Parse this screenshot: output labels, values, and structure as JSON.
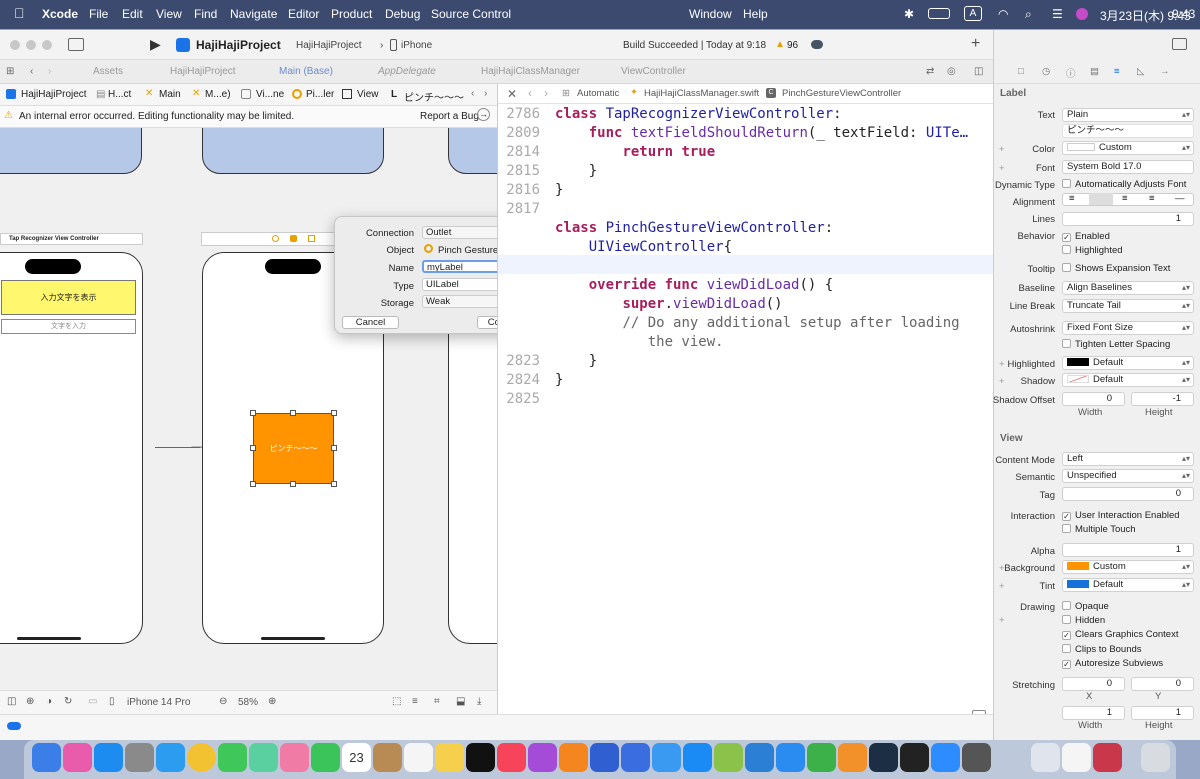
{
  "menubar": {
    "apple": "",
    "items": [
      "Xcode",
      "File",
      "Edit",
      "View",
      "Find",
      "Navigate",
      "Editor",
      "Product",
      "Debug",
      "Source Control",
      "Window",
      "Help"
    ],
    "input_mode": "A",
    "datetime": "3月23日(木) 9:43"
  },
  "toolbar": {
    "scheme": "HajiHajiProject",
    "device": "HajiHajiProject",
    "destination": "iPhone",
    "status": "Build Succeeded | Today at 9:18",
    "warnings": "96"
  },
  "tabs": [
    "Assets",
    "HajiHajiProject",
    "Main (Base)",
    "AppDelegate",
    "HajiHajiClassManager",
    "ViewController"
  ],
  "ib_jumpbar": [
    "HajiHajiProject",
    "H...ct",
    "Main",
    "M...e)",
    "Vi...ne",
    "Pi...ler",
    "View",
    "L",
    "ピンチ〜〜〜"
  ],
  "warning": {
    "text": "An internal error occurred. Editing functionality may be limited.",
    "action": "Report a Bug"
  },
  "canvas": {
    "scene1_title": "Tap Recognizer View Controller",
    "yellow_label": "入力文字を表示",
    "textfield_placeholder": "文字を入力",
    "orange_label": "ピンチ〜〜〜"
  },
  "ib_bottom": {
    "device": "iPhone 14 Pro",
    "zoom": "58%"
  },
  "editor_jumpbar": {
    "mode": "Automatic",
    "file": "HajiHajiClassManager.swift",
    "symbol": "PinchGestureViewController"
  },
  "code": [
    {
      "ln": "2786",
      "parts": [
        [
          "kw",
          "class "
        ],
        [
          "ty",
          "TapRecognizerViewController"
        ],
        [
          "",
          ":"
        ]
      ]
    },
    {
      "ln": "2809",
      "parts": [
        [
          "",
          "    "
        ],
        [
          "kw",
          "func "
        ],
        [
          "fn",
          "textFieldShouldReturn"
        ],
        [
          "",
          "(_ textField: "
        ],
        [
          "ty",
          "UITe…"
        ]
      ]
    },
    {
      "ln": "2814",
      "parts": [
        [
          "",
          "        "
        ],
        [
          "kw",
          "return true"
        ]
      ]
    },
    {
      "ln": "2815",
      "parts": [
        [
          "",
          "    }"
        ]
      ]
    },
    {
      "ln": "2816",
      "parts": [
        [
          "",
          "}"
        ]
      ]
    },
    {
      "ln": "2817",
      "parts": [
        [
          "",
          ""
        ]
      ]
    },
    {
      "ln": "",
      "parts": [
        [
          "kw",
          "class "
        ],
        [
          "ty",
          "PinchGestureViewController"
        ],
        [
          "",
          ":"
        ]
      ]
    },
    {
      "ln": "",
      "parts": [
        [
          "",
          "    "
        ],
        [
          "ty",
          "UIViewController"
        ],
        [
          "",
          ""
        ],
        [
          "",
          "{"
        ]
      ]
    },
    {
      "ln": "",
      "parts": [
        [
          "",
          ""
        ]
      ]
    },
    {
      "ln": "",
      "parts": [
        [
          "",
          "    "
        ],
        [
          "kw",
          "override func "
        ],
        [
          "fn",
          "viewDidLoad"
        ],
        [
          "",
          "() {"
        ]
      ]
    },
    {
      "ln": "",
      "parts": [
        [
          "",
          "        "
        ],
        [
          "kw",
          "super"
        ],
        [
          "",
          "."
        ],
        [
          "fn",
          "viewDidLoad"
        ],
        [
          "",
          "()"
        ]
      ]
    },
    {
      "ln": "",
      "parts": [
        [
          "",
          "        "
        ],
        [
          "cm",
          "// Do any additional setup after loading"
        ]
      ]
    },
    {
      "ln": "",
      "parts": [
        [
          "",
          "           "
        ],
        [
          "cm",
          "the view."
        ]
      ]
    },
    {
      "ln": "2823",
      "parts": [
        [
          "",
          "    }"
        ]
      ]
    },
    {
      "ln": "2824",
      "parts": [
        [
          "",
          "}"
        ]
      ]
    },
    {
      "ln": "2825",
      "parts": [
        [
          "",
          ""
        ]
      ]
    }
  ],
  "popover": {
    "connection_label": "Connection",
    "connection": "Outlet",
    "object_label": "Object",
    "object": "Pinch Gesture View...",
    "name_label": "Name",
    "name": "myLabel",
    "type_label": "Type",
    "type": "UILabel",
    "storage_label": "Storage",
    "storage": "Weak",
    "cancel": "Cancel",
    "connect": "Connect"
  },
  "inspector": {
    "label_section": "Label",
    "text_label": "Text",
    "text_type": "Plain",
    "text_value": "ピンチ〜〜〜",
    "color_label": "Color",
    "color_value": "Custom",
    "font_label": "Font",
    "font_value": "System Bold 17.0",
    "dyn_label": "Dynamic Type",
    "dyn_value": "Automatically Adjusts Font",
    "align_label": "Alignment",
    "lines_label": "Lines",
    "lines_value": "1",
    "behavior_label": "Behavior",
    "enabled": "Enabled",
    "highlighted": "Highlighted",
    "tooltip_label": "Tooltip",
    "tooltip_value": "Shows Expansion Text",
    "baseline_label": "Baseline",
    "baseline_value": "Align Baselines",
    "linebreak_label": "Line Break",
    "linebreak_value": "Truncate Tail",
    "autoshrink_label": "Autoshrink",
    "autoshrink_value": "Fixed Font Size",
    "tighten": "Tighten Letter Spacing",
    "highlighted_label": "Highlighted",
    "highlighted_value": "Default",
    "shadow_label": "Shadow",
    "shadow_value": "Default",
    "shadowoffset_label": "Shadow Offset",
    "shadow_w": "0",
    "shadow_h": "-1",
    "width": "Width",
    "height": "Height",
    "view_section": "View",
    "contentmode_label": "Content Mode",
    "contentmode_value": "Left",
    "semantic_label": "Semantic",
    "semantic_value": "Unspecified",
    "tag_label": "Tag",
    "tag_value": "0",
    "interaction_label": "Interaction",
    "uie": "User Interaction Enabled",
    "multitouch": "Multiple Touch",
    "alpha_label": "Alpha",
    "alpha_value": "1",
    "background_label": "Background",
    "background_value": "Custom",
    "tint_label": "Tint",
    "tint_value": "Default",
    "drawing_label": "Drawing",
    "opaque": "Opaque",
    "hidden": "Hidden",
    "clears": "Clears Graphics Context",
    "clips": "Clips to Bounds",
    "autoresize": "Autoresize Subviews",
    "stretching_label": "Stretching",
    "stretch_x": "0",
    "stretch_y": "0",
    "x": "X",
    "y": "Y",
    "stretch_w": "1",
    "stretch_h": "1"
  },
  "colors": {
    "orange": "#ff9400",
    "yellow": "#fff86e",
    "accent": "#1a73e8",
    "tint": "#1671d8"
  }
}
